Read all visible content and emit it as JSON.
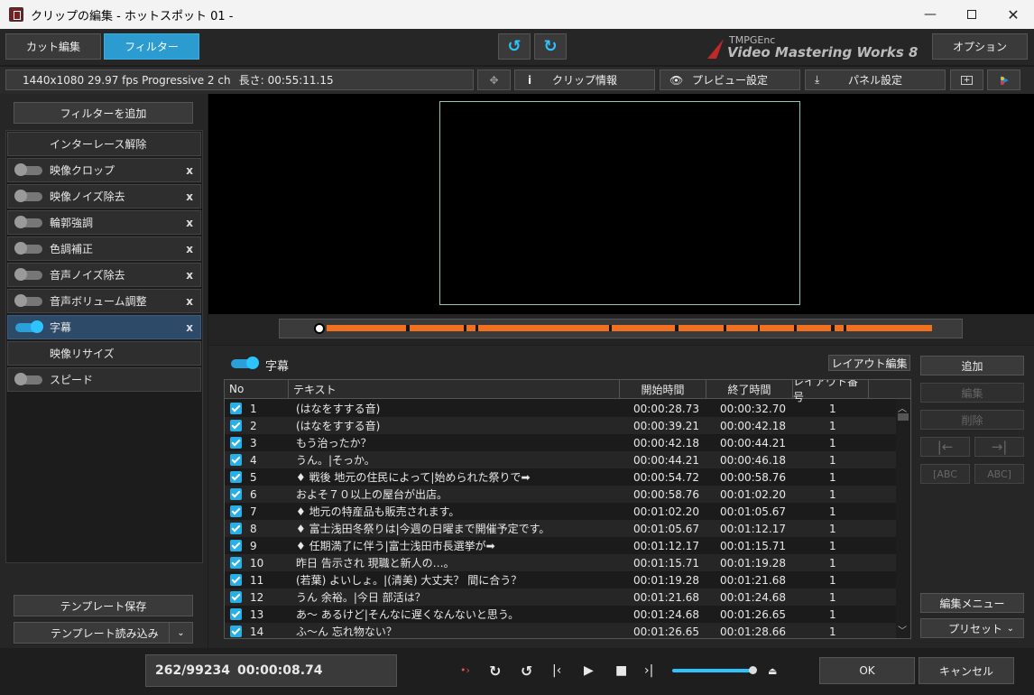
{
  "window": {
    "title": "クリップの編集 - ホットスポット 01 -"
  },
  "topbar": {
    "tab_cut": "カット編集",
    "tab_filter": "フィルター",
    "brand_small": "TMPGEnc",
    "brand_big": "Video Mastering Works 8",
    "options": "オプション"
  },
  "infobar": {
    "info": "1440x1080 29.97 fps Progressive 2 ch",
    "length_label": "長さ:",
    "length": "00:55:11.15",
    "clip_info": "クリップ情報",
    "preview_settings": "プレビュー設定",
    "panel_settings": "パネル設定"
  },
  "filters": {
    "add": "フィルターを追加",
    "items": [
      {
        "label": "インターレース解除",
        "header": true
      },
      {
        "label": "映像クロップ",
        "on": false
      },
      {
        "label": "映像ノイズ除去",
        "on": false
      },
      {
        "label": "輪郭強調",
        "on": false
      },
      {
        "label": "色調補正",
        "on": false
      },
      {
        "label": "音声ノイズ除去",
        "on": false
      },
      {
        "label": "音声ボリューム調整",
        "on": false
      },
      {
        "label": "字幕",
        "on": true,
        "selected": true
      },
      {
        "label": "映像リサイズ",
        "header": true
      },
      {
        "label": "スピード",
        "on": false,
        "nox": true
      }
    ],
    "x": "x",
    "save_template": "テンプレート保存",
    "load_template": "テンプレート読み込み"
  },
  "subtitles": {
    "title": "字幕",
    "layout_edit": "レイアウト編集",
    "columns": {
      "no": "No",
      "text": "テキスト",
      "start": "開始時間",
      "end": "終了時間",
      "layout": "レイアウト番号"
    },
    "rows": [
      {
        "no": "1",
        "text": "(はなをすする音)",
        "start": "00:00:28.73",
        "end": "00:00:32.70",
        "layout": "1"
      },
      {
        "no": "2",
        "text": "(はなをすする音)",
        "start": "00:00:39.21",
        "end": "00:00:42.18",
        "layout": "1"
      },
      {
        "no": "3",
        "text": "もう治ったか？",
        "start": "00:00:42.18",
        "end": "00:00:44.21",
        "layout": "1"
      },
      {
        "no": "4",
        "text": "うん。|そっか。",
        "start": "00:00:44.21",
        "end": "00:00:46.18",
        "layout": "1"
      },
      {
        "no": "5",
        "text": "♦ 戦後 地元の住民によって|始められた祭りで➡",
        "start": "00:00:54.72",
        "end": "00:00:58.76",
        "layout": "1"
      },
      {
        "no": "6",
        "text": "およそ７０以上の屋台が出店。",
        "start": "00:00:58.76",
        "end": "00:01:02.20",
        "layout": "1"
      },
      {
        "no": "7",
        "text": "♦ 地元の特産品も販売されます。",
        "start": "00:01:02.20",
        "end": "00:01:05.67",
        "layout": "1"
      },
      {
        "no": "8",
        "text": "♦ 富士浅田冬祭りは|今週の日曜まで開催予定です。",
        "start": "00:01:05.67",
        "end": "00:01:12.17",
        "layout": "1"
      },
      {
        "no": "9",
        "text": "♦ 任期満了に伴う|富士浅田市長選挙が➡",
        "start": "00:01:12.17",
        "end": "00:01:15.71",
        "layout": "1"
      },
      {
        "no": "10",
        "text": "昨日 告示され 現職と新人の…。",
        "start": "00:01:15.71",
        "end": "00:01:19.28",
        "layout": "1"
      },
      {
        "no": "11",
        "text": "(若葉) よいしょ。|(清美) 大丈夫？ 間に合う？",
        "start": "00:01:19.28",
        "end": "00:01:21.68",
        "layout": "1"
      },
      {
        "no": "12",
        "text": "うん 余裕。|今日 部活は？",
        "start": "00:01:21.68",
        "end": "00:01:24.68",
        "layout": "1"
      },
      {
        "no": "13",
        "text": "あ～ あるけど|そんなに遅くなんないと思う。",
        "start": "00:01:24.68",
        "end": "00:01:26.65",
        "layout": "1"
      },
      {
        "no": "14",
        "text": "ふ～ん 忘れ物ない？",
        "start": "00:01:26.65",
        "end": "00:01:28.66",
        "layout": "1"
      }
    ]
  },
  "side": {
    "add": "追加",
    "edit": "編集",
    "delete": "削除",
    "abc": "ABC",
    "edit_menu": "編集メニュー",
    "preset": "プリセット"
  },
  "footer": {
    "frame": "262/99234",
    "time": "00:00:08.74",
    "ok": "OK",
    "cancel": "キャンセル"
  },
  "colors": {
    "accent": "#27b0e8",
    "timeline": "#f07020"
  }
}
